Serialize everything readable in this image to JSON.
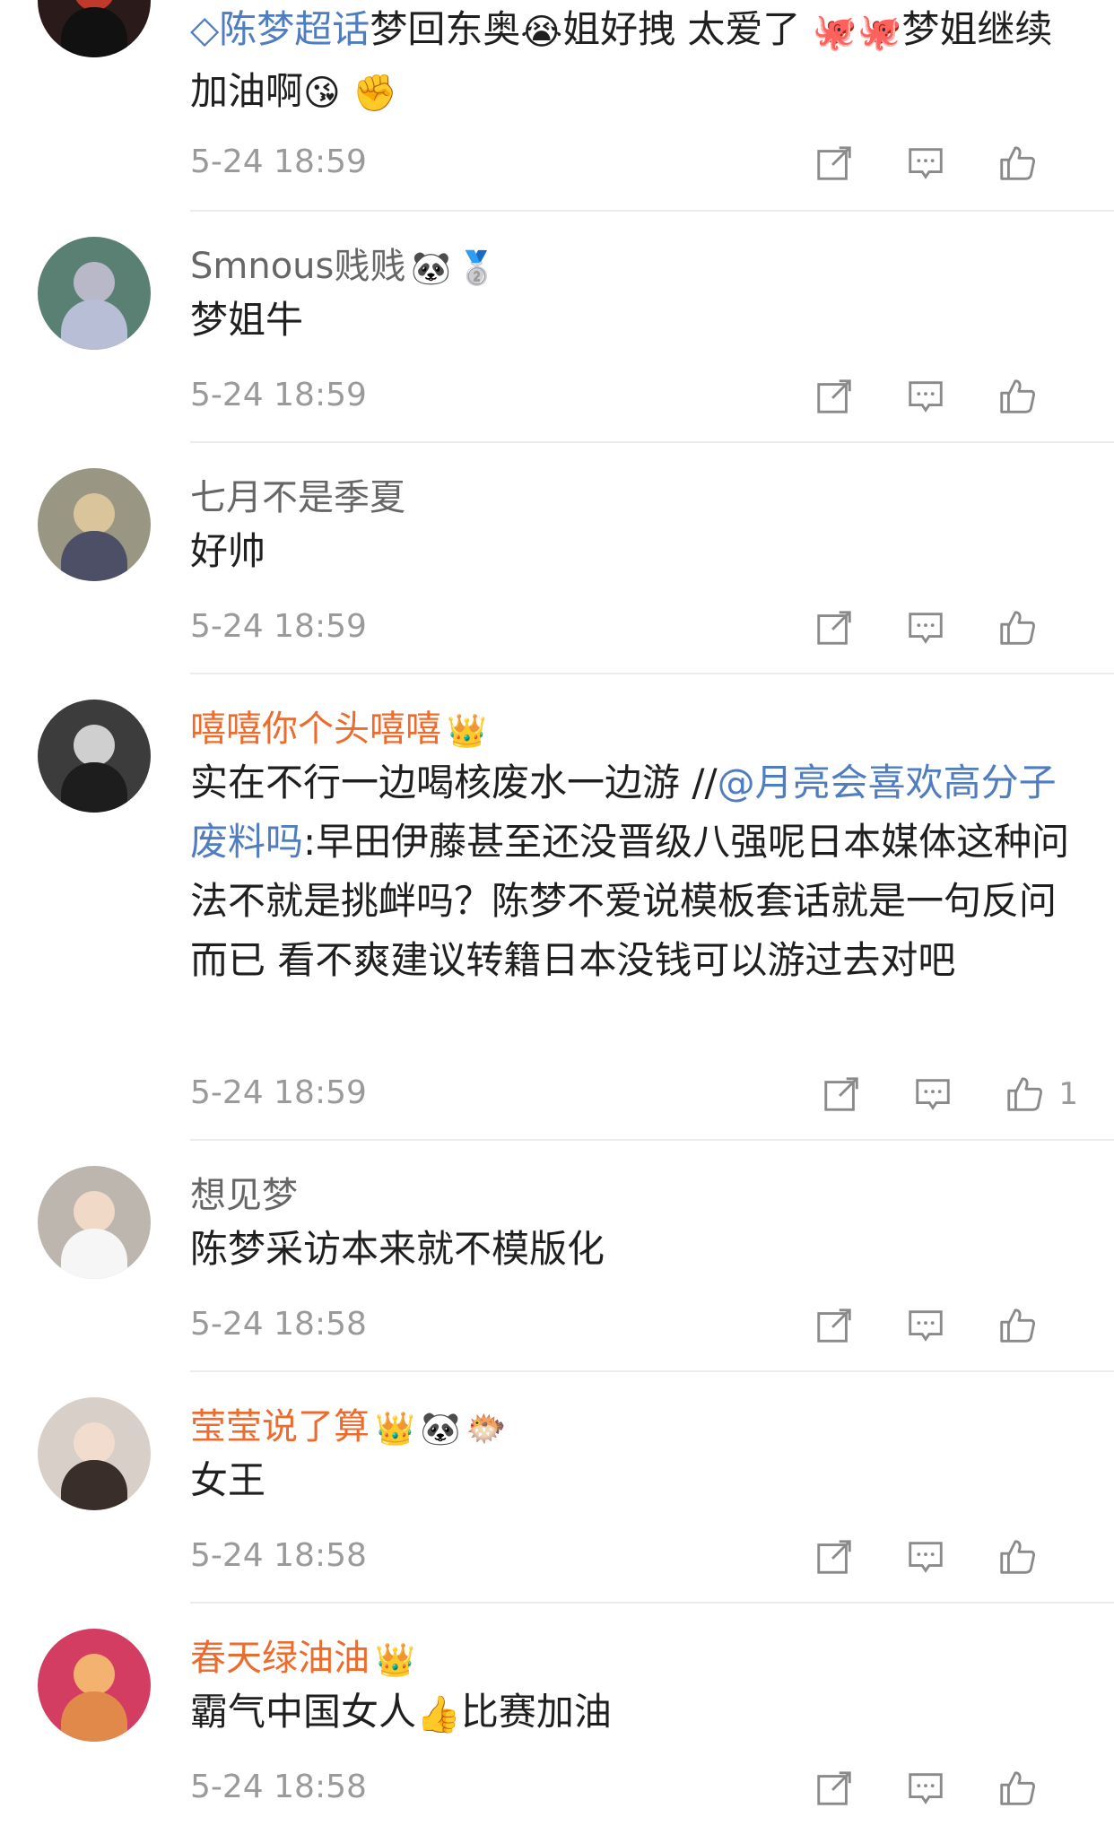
{
  "comments": [
    {
      "name": "",
      "text_parts": {
        "topic": "◇陈梦超话",
        "t1": "梦回东奥",
        "e1": "😭",
        "t2": "姐好拽 太爱了",
        "e2": "🐙",
        "e3": "🐙",
        "t3": "梦姐继续加油啊",
        "e4": "😘",
        "e5": "✊"
      },
      "time": "5-24 18:59",
      "likes": ""
    },
    {
      "name": "Smnous贱贱",
      "badges": [
        "🐼",
        "🥈"
      ],
      "text": "梦姐牛",
      "time": "5-24 18:59",
      "likes": ""
    },
    {
      "name": "七月不是季夏",
      "badges": [],
      "text": "好帅",
      "time": "5-24 18:59",
      "likes": ""
    },
    {
      "name": "嘻嘻你个头嘻嘻",
      "badges": [
        "👑"
      ],
      "text_parts": {
        "t1": "实在不行一边喝核废水一边游 //",
        "mention": "@月亮会喜欢高分子废料吗",
        "t2": ":早田伊藤甚至还没晋级八强呢日本媒体这种问法不就是挑衅吗？陈梦不爱说模板套话就是一句反问而已 看不爽建议转籍日本没钱可以游过去对吧"
      },
      "time": "5-24 18:59",
      "likes": "1"
    },
    {
      "name": "想见梦",
      "badges": [],
      "text": "陈梦采访本来就不模版化",
      "time": "5-24 18:58",
      "likes": ""
    },
    {
      "name": "莹莹说了算",
      "badges": [
        "👑",
        "🐼",
        "🐡"
      ],
      "text": "女王",
      "time": "5-24 18:58",
      "likes": ""
    },
    {
      "name": "春天绿油油",
      "badges": [
        "👑"
      ],
      "text_parts": {
        "t1": "霸气中国女人",
        "e1": "👍",
        "t2": "比赛加油"
      },
      "time": "5-24 18:58",
      "likes": ""
    }
  ],
  "icons": {
    "share": "share-icon",
    "comment": "comment-icon",
    "like": "like-icon"
  },
  "colors": {
    "username_gray": "#666666",
    "username_vip": "#ec6b2d",
    "link": "#4f7dbf",
    "time": "#9a9a9a"
  }
}
